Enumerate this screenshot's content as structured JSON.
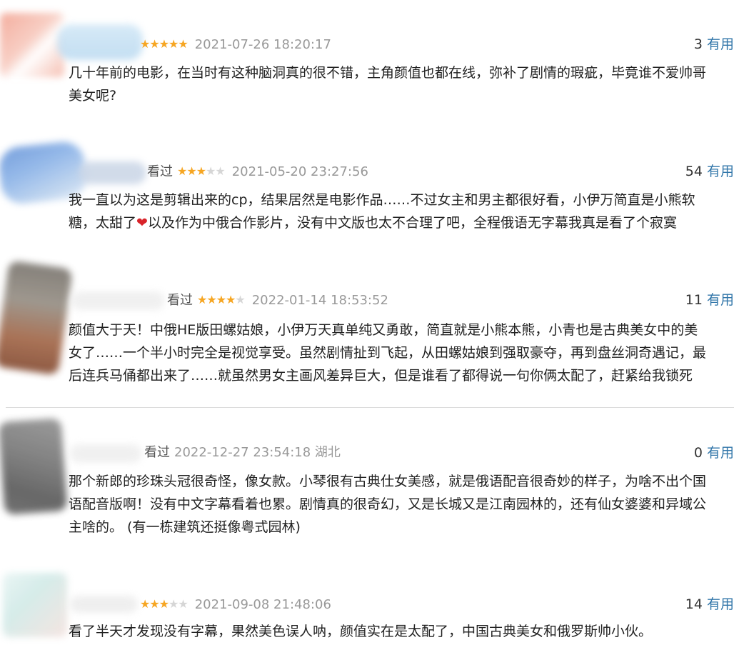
{
  "reviews": [
    {
      "status": "",
      "rating": 5,
      "time": "2021-07-26 18:20:17",
      "location": "",
      "useful_count": "3",
      "useful_label": "有用",
      "content": "几十年前的电影，在当时有这种脑洞真的很不错，主角颜值也都在线，弥补了剧情的瑕疵，毕竟谁不爱帅哥\n美女呢?"
    },
    {
      "status": "看过",
      "rating": 3,
      "time": "2021-05-20 23:27:56",
      "location": "",
      "useful_count": "54",
      "useful_label": "有用",
      "content_before_heart": "我一直以为这是剪辑出来的cp，结果居然是电影作品……不过女主和男主都很好看，小伊万简直是小熊软\n糖，太甜了",
      "heart": "❤",
      "content_after_heart": "以及作为中俄合作影片，没有中文版也太不合理了吧，全程俄语无字幕我真是看了个寂寞"
    },
    {
      "status": "看过",
      "rating": 4,
      "time": "2022-01-14 18:53:52",
      "location": "",
      "useful_count": "11",
      "useful_label": "有用",
      "content": "颜值大于天！中俄HE版田螺姑娘，小伊万天真单纯又勇敢，简直就是小熊本熊，小青也是古典美女中的美\n女了……一个半小时完全是视觉享受。虽然剧情扯到飞起，从田螺姑娘到强取豪夺，再到盘丝洞奇遇记，最\n后连兵马俑都出来了……就虽然男女主画风差异巨大，但是谁看了都得说一句你俩太配了，赶紧给我锁死"
    },
    {
      "status": "看过",
      "rating": 0,
      "time": "2022-12-27 23:54:18",
      "location": "湖北",
      "useful_count": "0",
      "useful_label": "有用",
      "content": "那个新郎的珍珠头冠很奇怪，像女款。小琴很有古典仕女美感，就是俄语配音很奇妙的样子，为啥不出个国\n语配音版啊！没有中文字幕看着也累。剧情真的很奇幻，又是长城又是江南园林的，还有仙女婆婆和异域公\n主啥的。 (有一栋建筑还挺像粤式园林)"
    },
    {
      "status": "",
      "rating": 3,
      "time": "2021-09-08 21:48:06",
      "location": "",
      "useful_count": "14",
      "useful_label": "有用",
      "content": "看了半天才发现没有字幕，果然美色误人呐，颜值实在是太配了，中国古典美女和俄罗斯帅小伙。"
    }
  ],
  "colors": {
    "star_on": "#f6a623",
    "star_off": "#d6d6d6",
    "link": "#3377aa",
    "meta": "#999999"
  }
}
